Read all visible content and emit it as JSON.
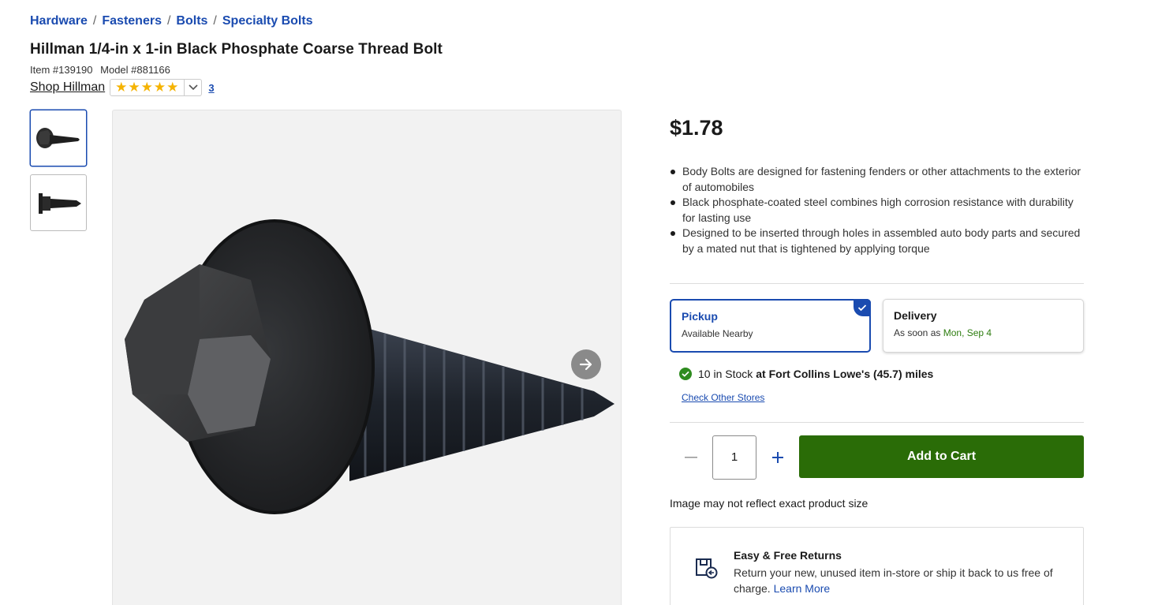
{
  "breadcrumb": {
    "items": [
      "Hardware",
      "Fasteners",
      "Bolts",
      "Specialty Bolts"
    ],
    "separator": "/"
  },
  "product": {
    "title": "Hillman 1/4-in x 1-in Black Phosphate Coarse Thread Bolt",
    "item_number": "Item #139190",
    "model_number": "Model #881166",
    "brand_link": "Shop Hillman",
    "rating": {
      "stars": "★★★★★",
      "value_out_of_5": 5,
      "review_count": "3"
    }
  },
  "gallery": {
    "thumbnails": [
      {
        "icon": "bolt-angled-thumbnail",
        "selected": true
      },
      {
        "icon": "bolt-side-thumbnail",
        "selected": false
      }
    ],
    "next_icon": "arrow-right-icon"
  },
  "price": "$1.78",
  "bullets": [
    "Body Bolts are designed for fastening fenders or other attachments to the exterior of automobiles",
    "Black phosphate-coated steel combines high corrosion resistance with durability for lasting use",
    "Designed to be inserted through holes in assembled auto body parts and secured by a mated nut that is tightened by applying torque"
  ],
  "fulfillment": {
    "pickup": {
      "title": "Pickup",
      "subtitle": "Available Nearby",
      "selected": true
    },
    "delivery": {
      "title": "Delivery",
      "subtitle_prefix": "As soon as",
      "date": "Mon, Sep 4"
    }
  },
  "stock": {
    "count_text": "10 in Stock",
    "location_text": "at Fort Collins Lowe's (45.7) miles",
    "check_other": "Check Other Stores"
  },
  "cart": {
    "quantity": "1",
    "minus_symbol": "–",
    "plus_symbol": "+",
    "add_label": "Add to Cart"
  },
  "image_note": "Image may not reflect exact product size",
  "returns": {
    "title": "Easy & Free Returns",
    "text": "Return your new, unused item in-store or ship it back to us free of charge.",
    "link": "Learn More"
  },
  "colors": {
    "link_blue": "#1a4bb0",
    "cart_green": "#2a6c07",
    "stock_green": "#2e8b1f",
    "star_gold": "#f5b301"
  }
}
